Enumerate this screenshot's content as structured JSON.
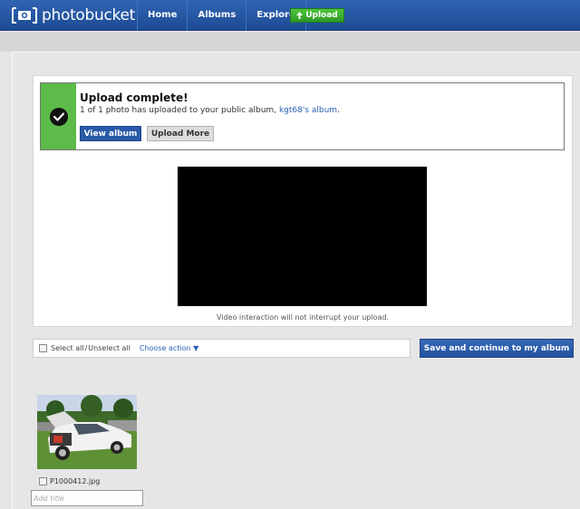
{
  "header": {
    "logo_text": "photobucket",
    "nav": [
      {
        "label": "Home"
      },
      {
        "label": "Albums"
      },
      {
        "label": "Explore"
      }
    ],
    "upload_label": "Upload",
    "upload_icon": "arrow-up-icon"
  },
  "notice": {
    "icon": "check-circle-icon",
    "title": "Upload complete!",
    "text_before": "1 of 1 photo has uploaded to your public album,",
    "album_link": "kgt68's album",
    "text_after": ".",
    "view_album_label": "View album",
    "upload_more_label": "Upload More",
    "accent_color": "#5cbb49"
  },
  "video": {
    "note": "Video interaction will not interrupt your upload."
  },
  "selection": {
    "select_all_label": "Select all",
    "separator": "/",
    "unselect_all_label": "Unselect all",
    "choose_action_label": "Choose action",
    "choose_action_icon": "caret-down-icon",
    "save_label": "Save and continue to my album"
  },
  "photos": [
    {
      "filename": "P1000412.jpg",
      "title_placeholder": "Add title",
      "title_value": ""
    }
  ]
}
